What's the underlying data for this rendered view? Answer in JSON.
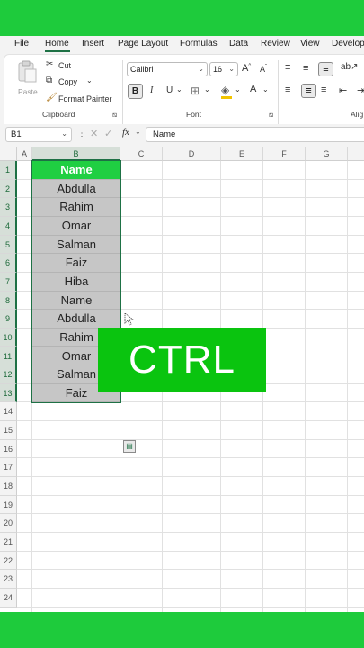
{
  "menu": [
    "File",
    "Home",
    "Insert",
    "Page Layout",
    "Formulas",
    "Data",
    "Review",
    "View",
    "Develop"
  ],
  "active_menu": "Home",
  "clipboard": {
    "paste": "Paste",
    "cut": "Cut",
    "copy": "Copy",
    "format_painter": "Format Painter",
    "group": "Clipboard"
  },
  "font": {
    "name": "Calibri",
    "size": "16",
    "bold": "B",
    "italic": "I",
    "underline": "U",
    "grow": "A",
    "shrink": "A",
    "font_color": "A",
    "group": "Font"
  },
  "alignment": {
    "group": "Alig"
  },
  "formula_bar": {
    "name_box": "B1",
    "fx": "fx",
    "value": "Name"
  },
  "columns": [
    "A",
    "B",
    "C",
    "D",
    "E",
    "F",
    "G"
  ],
  "rows": [
    "1",
    "2",
    "3",
    "4",
    "5",
    "6",
    "7",
    "8",
    "9",
    "10",
    "11",
    "12",
    "13",
    "14",
    "15",
    "16",
    "17",
    "18",
    "19",
    "20",
    "21",
    "22",
    "23",
    "24"
  ],
  "column_b": [
    "Name",
    "Abdulla",
    "Rahim",
    "Omar",
    "Salman",
    "Faiz",
    "Hiba",
    "Name",
    "Abdulla",
    "Rahim",
    "Omar",
    "Salman",
    "Faiz"
  ],
  "overlay": {
    "text": "CTRL"
  },
  "colors": {
    "background": "#1ecb3c",
    "header_cell": "#1fcf42",
    "selection_fill": "#c6c6c6",
    "accent": "#1e7145",
    "overlay": "#0ac40f"
  }
}
